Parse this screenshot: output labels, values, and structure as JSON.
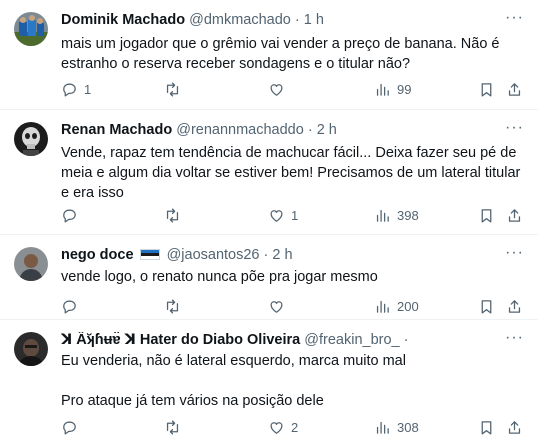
{
  "tweets": [
    {
      "name": "Dominik Machado",
      "handle": "@dmkmachado",
      "time": "1 h",
      "text": [
        "mais um jogador que o grêmio vai vender a preço de banana. Não é estranho o reserva receber sondagens e o titular não?"
      ],
      "replies": "1",
      "retweets": "",
      "likes": "",
      "views": "99",
      "avatar_icon": "team-jersey-avatar"
    },
    {
      "name": "Renan Machado",
      "handle": "@renannmachaddo",
      "time": "2 h",
      "text": [
        "Vende, rapaz tem tendência de machucar fácil... Deixa fazer seu pé de meia e algum dia voltar se estiver bem! Precisamos de um lateral titular e era isso"
      ],
      "replies": "",
      "retweets": "",
      "likes": "1",
      "views": "398",
      "avatar_icon": "skull-avatar"
    },
    {
      "name": "nego doce",
      "handle": "@jaosantos26",
      "time": "2 h",
      "text": [
        "vende logo, o renato nunca põe pra jogar mesmo"
      ],
      "replies": "",
      "retweets": "",
      "likes": "",
      "views": "200",
      "avatar_icon": "photo-avatar",
      "flag_colors": [
        "#1f6fc4",
        "#1a1a1a",
        "#ffffff"
      ]
    },
    {
      "name": "ꓘ A̋ʞ̆ɦʉɐ̈ ꓘ Hater do Diabo Oliveira",
      "handle": "@freakin_bro_",
      "time": "",
      "text": [
        "Eu venderia, não é lateral esquerdo, marca muito mal",
        "Pro ataque já tem vários na posição dele"
      ],
      "replies": "",
      "retweets": "",
      "likes": "2",
      "views": "308",
      "avatar_icon": "dark-photo-avatar"
    }
  ],
  "ui": {
    "dot": "·",
    "more": "···",
    "colors": {
      "text": "#0f1419",
      "muted": "#536471",
      "divider": "#eff3f4"
    }
  }
}
